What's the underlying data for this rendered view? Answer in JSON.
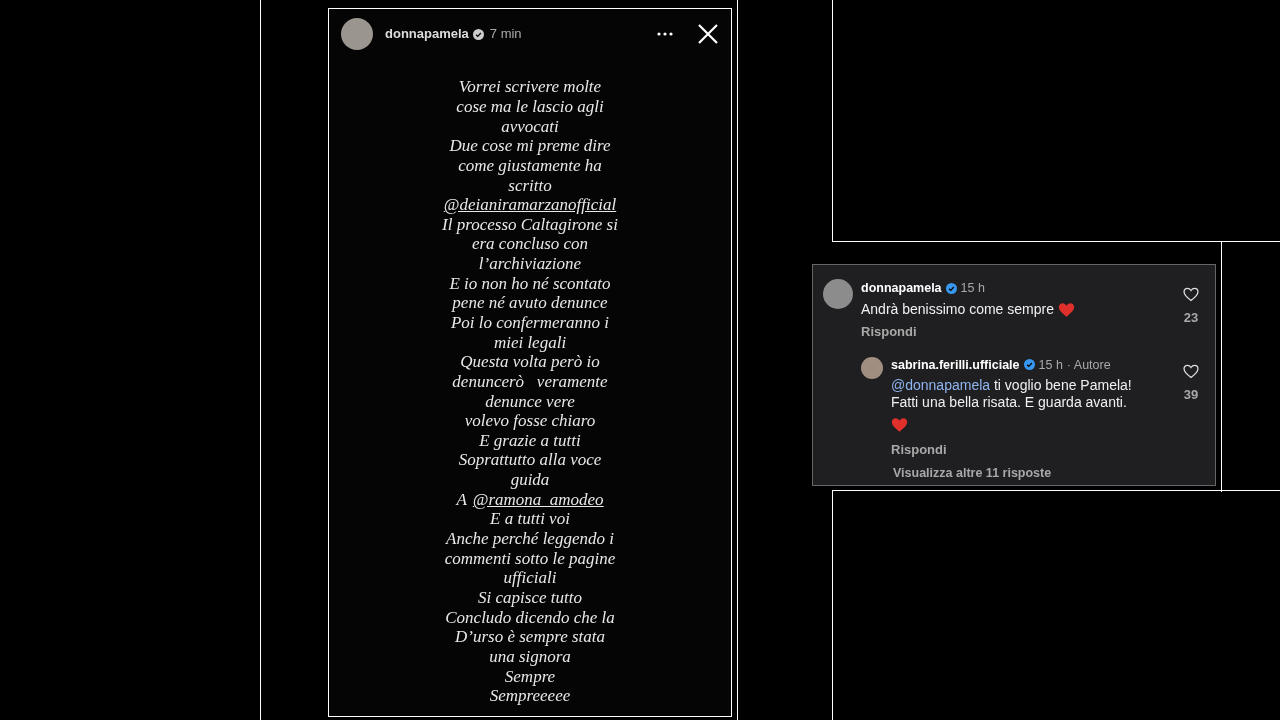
{
  "story": {
    "username": "donnapamela",
    "verified": true,
    "time": "7 min",
    "lines": [
      [
        {
          "kind": "text",
          "text": "Vorrei scrivere molte"
        }
      ],
      [
        {
          "kind": "text",
          "text": "cose ma le lascio agli"
        }
      ],
      [
        {
          "kind": "text",
          "text": "avvocati"
        }
      ],
      [
        {
          "kind": "text",
          "text": "Due cose mi preme dire"
        }
      ],
      [
        {
          "kind": "text",
          "text": "come giustamente ha"
        }
      ],
      [
        {
          "kind": "text",
          "text": "scritto"
        }
      ],
      [
        {
          "kind": "mention",
          "text": "@deianiramarzanofficial"
        }
      ],
      [
        {
          "kind": "text",
          "text": "Il processo Caltagirone si"
        }
      ],
      [
        {
          "kind": "text",
          "text": "era concluso con"
        }
      ],
      [
        {
          "kind": "text",
          "text": "l’archiviazione"
        }
      ],
      [
        {
          "kind": "text",
          "text": "E io non ho né scontato"
        }
      ],
      [
        {
          "kind": "text",
          "text": "pene né avuto denunce"
        }
      ],
      [
        {
          "kind": "text",
          "text": "Poi lo confermeranno i"
        }
      ],
      [
        {
          "kind": "text",
          "text": "miei legali"
        }
      ],
      [
        {
          "kind": "text",
          "text": "Questa volta però io"
        }
      ],
      [
        {
          "kind": "text",
          "text": "denuncerò   veramente"
        }
      ],
      [
        {
          "kind": "text",
          "text": "denunce vere"
        }
      ],
      [
        {
          "kind": "text",
          "text": "volevo fosse chiaro"
        }
      ],
      [
        {
          "kind": "text",
          "text": "E grazie a tutti"
        }
      ],
      [
        {
          "kind": "text",
          "text": "Soprattutto alla voce"
        }
      ],
      [
        {
          "kind": "text",
          "text": "guida"
        }
      ],
      [
        {
          "kind": "text",
          "text": "A"
        },
        {
          "kind": "mention",
          "text": "@ramona_amodeo"
        }
      ],
      [
        {
          "kind": "text",
          "text": "E a tutti voi"
        }
      ],
      [
        {
          "kind": "text",
          "text": "Anche perché leggendo i"
        }
      ],
      [
        {
          "kind": "text",
          "text": "commenti sotto le pagine"
        }
      ],
      [
        {
          "kind": "text",
          "text": "ufficiali"
        }
      ],
      [
        {
          "kind": "text",
          "text": "Si capisce tutto"
        }
      ],
      [
        {
          "kind": "text",
          "text": "Concludo dicendo che la"
        }
      ],
      [
        {
          "kind": "text",
          "text": "D’urso è sempre stata"
        }
      ],
      [
        {
          "kind": "text",
          "text": "una signora"
        }
      ],
      [
        {
          "kind": "text",
          "text": "Sempre"
        }
      ],
      [
        {
          "kind": "text",
          "text": "Sempreeeee"
        }
      ]
    ]
  },
  "comments": [
    {
      "username": "donnapamela",
      "verified": true,
      "time": "15 h",
      "text": "Andrà benissimo come sempre",
      "reply": "Rispondi",
      "likes": "23",
      "reply_level": false
    },
    {
      "username": "sabrina.ferilli.ufficiale",
      "verified": true,
      "time": "15 h",
      "author": "· Autore",
      "mention": "@donnapamela",
      "text": "ti voglio bene Pamela! Fatti una bella risata. E guarda avanti.",
      "reply": "Rispondi",
      "likes": "39",
      "reply_level": true
    }
  ],
  "more_replies": "Visualizza altre 11 risposte"
}
